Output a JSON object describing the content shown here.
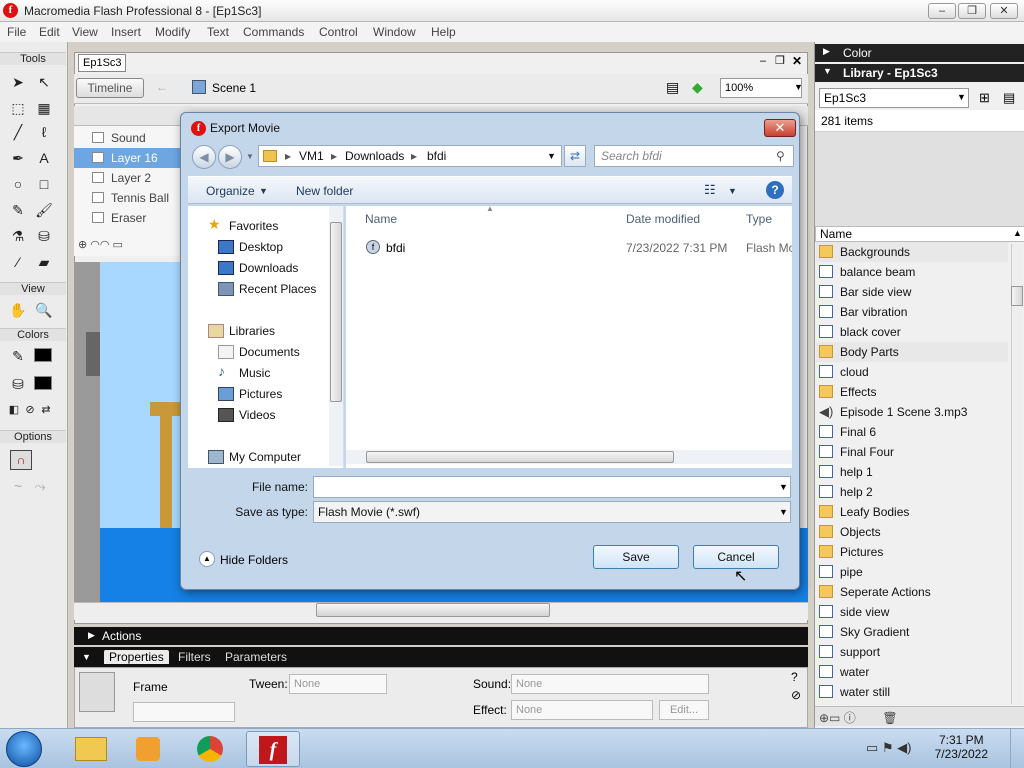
{
  "window": {
    "title": "Macromedia Flash Professional 8 - [Ep1Sc3]",
    "logo": "f",
    "min": "–",
    "max": "❐",
    "close": "✕"
  },
  "menu": [
    "File",
    "Edit",
    "View",
    "Insert",
    "Modify",
    "Text",
    "Commands",
    "Control",
    "Window",
    "Help"
  ],
  "tools": {
    "title": "Tools",
    "view": "View",
    "colors": "Colors",
    "options": "Options"
  },
  "document": {
    "tab": "Ep1Sc3",
    "timeline_btn": "Timeline",
    "scene": "Scene 1",
    "zoom": "100%"
  },
  "layers": [
    "Sound",
    "Layer 16",
    "Layer 2",
    "Tennis Ball",
    "Eraser"
  ],
  "dock": {
    "color": "Color",
    "library_title": "Library - Ep1Sc3",
    "library_select": "Ep1Sc3",
    "item_count": "281 items",
    "name_col": "Name"
  },
  "library": [
    {
      "name": "Backgrounds",
      "icon": "folder-icon"
    },
    {
      "name": "balance beam",
      "icon": "symbol-icon"
    },
    {
      "name": "Bar side view",
      "icon": "symbol-icon"
    },
    {
      "name": "Bar vibration",
      "icon": "symbol-icon"
    },
    {
      "name": "black cover",
      "icon": "symbol-icon"
    },
    {
      "name": "Body Parts",
      "icon": "folder-icon"
    },
    {
      "name": "cloud",
      "icon": "symbol-icon"
    },
    {
      "name": "Effects",
      "icon": "folder-icon"
    },
    {
      "name": "Episode 1 Scene 3.mp3",
      "icon": "sound-icon"
    },
    {
      "name": "Final 6",
      "icon": "symbol-icon"
    },
    {
      "name": "Final Four",
      "icon": "symbol-icon"
    },
    {
      "name": "help 1",
      "icon": "symbol-icon"
    },
    {
      "name": "help 2",
      "icon": "symbol-icon"
    },
    {
      "name": "Leafy Bodies",
      "icon": "folder-icon"
    },
    {
      "name": "Objects",
      "icon": "folder-icon"
    },
    {
      "name": "Pictures",
      "icon": "folder-icon"
    },
    {
      "name": "pipe",
      "icon": "symbol-icon"
    },
    {
      "name": "Seperate Actions",
      "icon": "folder-icon"
    },
    {
      "name": "side view",
      "icon": "symbol-icon"
    },
    {
      "name": "Sky Gradient",
      "icon": "symbol-icon"
    },
    {
      "name": "support",
      "icon": "symbol-icon"
    },
    {
      "name": "water",
      "icon": "symbol-icon"
    },
    {
      "name": "water still",
      "icon": "symbol-icon"
    }
  ],
  "actions": "Actions",
  "properties": {
    "tabs": [
      "Properties",
      "Filters",
      "Parameters"
    ],
    "frame_label": "Frame",
    "tween_label": "Tween:",
    "tween_value": "None",
    "sound_label": "Sound:",
    "sound_value": "None",
    "effect_label": "Effect:",
    "effect_value": "None",
    "edit_btn": "Edit..."
  },
  "dialog": {
    "title": "Export Movie",
    "path": [
      "VM1",
      "Downloads",
      "bfdi"
    ],
    "search_placeholder": "Search bfdi",
    "organize": "Organize",
    "new_folder": "New folder",
    "nav": {
      "favorites": "Favorites",
      "favorites_items": [
        "Desktop",
        "Downloads",
        "Recent Places"
      ],
      "libraries": "Libraries",
      "libraries_items": [
        "Documents",
        "Music",
        "Pictures",
        "Videos"
      ],
      "computer": "My Computer"
    },
    "columns": [
      "Name",
      "Date modified",
      "Type"
    ],
    "files": [
      {
        "name": "bfdi",
        "date": "7/23/2022 7:31 PM",
        "type": "Flash Mov"
      }
    ],
    "file_name_label": "File name:",
    "file_name_value": "",
    "save_type_label": "Save as type:",
    "save_type_value": "Flash Movie (*.swf)",
    "hide_folders": "Hide Folders",
    "save": "Save",
    "cancel": "Cancel"
  },
  "taskbar": {
    "time": "7:31 PM",
    "date": "7/23/2022"
  }
}
